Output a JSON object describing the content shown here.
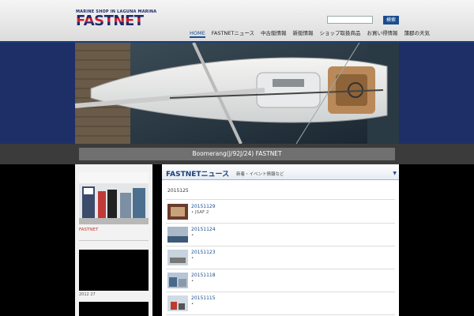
{
  "header": {
    "logo_tagline": "MARINE SHOP IN LAGUNA MARINA",
    "logo_name": "FASTNET",
    "search_placeholder": "",
    "search_button": "検索",
    "nav": [
      {
        "label": "HOME",
        "active": true
      },
      {
        "label": "FASTNETニュース"
      },
      {
        "label": "中古艇情報"
      },
      {
        "label": "新艇情報"
      },
      {
        "label": "ショップ取扱商品"
      },
      {
        "label": "お買い得情報"
      },
      {
        "label": "蒲郡の天気"
      }
    ]
  },
  "banner": {
    "caption": "Boomerang(J/92J/24) FASTNET"
  },
  "sidebar": {
    "shop_label": "FASTNET",
    "video_date": "2012 27"
  },
  "main": {
    "title": "FASTNETニュース",
    "subtitle": "新着・イベント情報など",
    "date": "2015125",
    "news": [
      {
        "date": "20151129",
        "text": "• JSAF 2"
      },
      {
        "date": "20151124",
        "text": "•"
      },
      {
        "date": "20151123",
        "text": "•"
      },
      {
        "date": "20151118",
        "text": "•"
      },
      {
        "date": "20151115",
        "text": "•"
      }
    ]
  },
  "colors": {
    "brand_blue": "#1b3f7a",
    "brand_red": "#d21f2a",
    "banner_bg": "#1d2f66"
  }
}
